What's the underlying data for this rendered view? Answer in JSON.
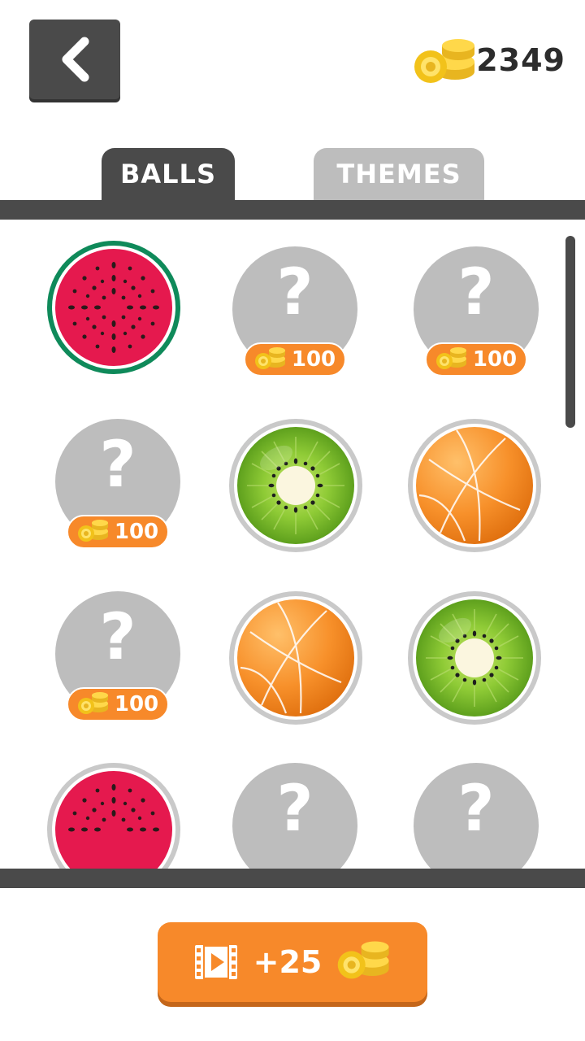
{
  "header": {
    "coin_count": "2349"
  },
  "tabs": [
    {
      "label": "BALLS",
      "active": true
    },
    {
      "label": "THEMES",
      "active": false
    }
  ],
  "grid": {
    "price_label": "100",
    "items": [
      {
        "row": 1,
        "col": 1,
        "type": "watermelon",
        "state": "selected"
      },
      {
        "row": 1,
        "col": 2,
        "type": "locked",
        "price": "100"
      },
      {
        "row": 1,
        "col": 3,
        "type": "locked",
        "price": "100"
      },
      {
        "row": 2,
        "col": 1,
        "type": "locked",
        "price": "100"
      },
      {
        "row": 2,
        "col": 2,
        "type": "kiwi",
        "state": "owned"
      },
      {
        "row": 2,
        "col": 3,
        "type": "basketball",
        "state": "owned"
      },
      {
        "row": 3,
        "col": 1,
        "type": "locked",
        "price": "100"
      },
      {
        "row": 3,
        "col": 2,
        "type": "basketball",
        "state": "owned"
      },
      {
        "row": 3,
        "col": 3,
        "type": "kiwi",
        "state": "owned"
      },
      {
        "row": 4,
        "col": 1,
        "type": "watermelon",
        "state": "owned"
      },
      {
        "row": 4,
        "col": 2,
        "type": "locked"
      },
      {
        "row": 4,
        "col": 3,
        "type": "locked"
      }
    ]
  },
  "reward_button": {
    "label": "+25"
  },
  "colors": {
    "dark": "#4a4a4a",
    "locked": "#bdbdbd",
    "accent": "#f7892a",
    "watermelon": "#e5194e",
    "watermelon_rind": "#0f8a5a",
    "kiwi": "#7bbf2c",
    "basketball": "#f58a1f"
  },
  "icons": [
    "back-chevron-icon",
    "coin-stack-icon",
    "question-icon",
    "video-film-icon"
  ]
}
